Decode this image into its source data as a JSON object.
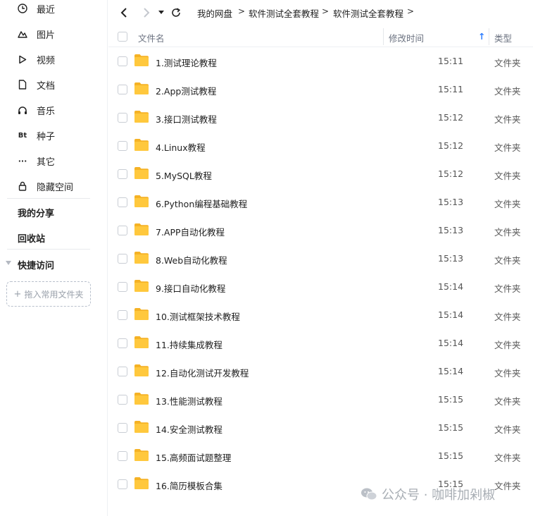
{
  "sidebar": {
    "items": [
      {
        "label": "最近",
        "icon": "clock-icon"
      },
      {
        "label": "图片",
        "icon": "image-icon"
      },
      {
        "label": "视频",
        "icon": "play-icon"
      },
      {
        "label": "文档",
        "icon": "document-icon"
      },
      {
        "label": "音乐",
        "icon": "headphones-icon"
      },
      {
        "label": "种子",
        "icon": "bt-icon",
        "icon_text": "Bt"
      },
      {
        "label": "其它",
        "icon": "more-icon",
        "icon_text": "···"
      },
      {
        "label": "隐藏空间",
        "icon": "lock-icon"
      }
    ],
    "my_share": "我的分享",
    "recycle_bin": "回收站",
    "quick_access": "快捷访问",
    "drop_placeholder": "拖入常用文件夹",
    "drop_plus": "+"
  },
  "toolbar": {
    "breadcrumb": [
      "我的网盘",
      "软件测试全套教程",
      "软件测试全套教程"
    ],
    "separator": ">"
  },
  "header": {
    "name_col": "文件名",
    "time_col": "修改时间",
    "type_col": "类型",
    "sort_arrow": "↑"
  },
  "files": [
    {
      "name": "1.测试理论教程",
      "time": "15:11",
      "type": "文件夹"
    },
    {
      "name": "2.App测试教程",
      "time": "15:11",
      "type": "文件夹"
    },
    {
      "name": "3.接口测试教程",
      "time": "15:12",
      "type": "文件夹"
    },
    {
      "name": "4.Linux教程",
      "time": "15:12",
      "type": "文件夹"
    },
    {
      "name": "5.MySQL教程",
      "time": "15:12",
      "type": "文件夹"
    },
    {
      "name": "6.Python编程基础教程",
      "time": "15:13",
      "type": "文件夹"
    },
    {
      "name": "7.APP自动化教程",
      "time": "15:13",
      "type": "文件夹"
    },
    {
      "name": "8.Web自动化教程",
      "time": "15:13",
      "type": "文件夹"
    },
    {
      "name": "9.接口自动化教程",
      "time": "15:14",
      "type": "文件夹"
    },
    {
      "name": "10.测试框架技术教程",
      "time": "15:14",
      "type": "文件夹"
    },
    {
      "name": "11.持续集成教程",
      "time": "15:14",
      "type": "文件夹"
    },
    {
      "name": "12.自动化测试开发教程",
      "time": "15:14",
      "type": "文件夹"
    },
    {
      "name": "13.性能测试教程",
      "time": "15:15",
      "type": "文件夹"
    },
    {
      "name": "14.安全测试教程",
      "time": "15:15",
      "type": "文件夹"
    },
    {
      "name": "15.高频面试题整理",
      "time": "15:15",
      "type": "文件夹"
    },
    {
      "name": "16.简历模板合集",
      "time": "15:15",
      "type": "文件夹"
    }
  ],
  "watermark": {
    "text": "公众号 · 咖啡加剁椒",
    "icon": "wechat-icon"
  },
  "colors": {
    "folder": "#FFC83D",
    "folder_dark": "#F5B225",
    "accent": "#2b7cff"
  }
}
